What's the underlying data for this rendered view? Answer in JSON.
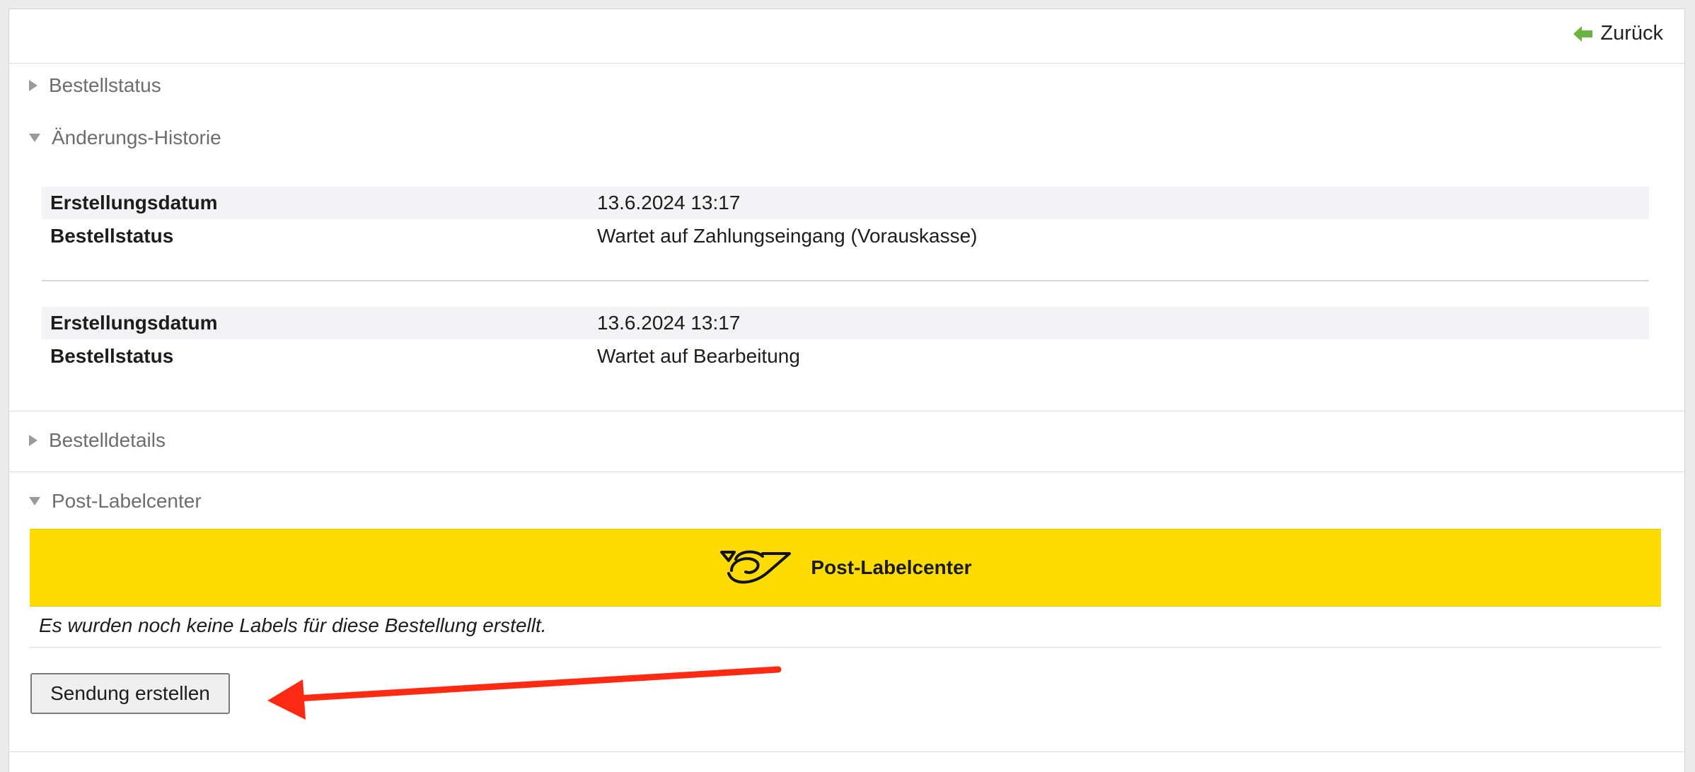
{
  "header": {
    "back_label": "Zurück",
    "back_icon": "arrow-left-icon",
    "accent_color": "#6db33f"
  },
  "sections": {
    "order_status": {
      "title": "Bestellstatus"
    },
    "history": {
      "title": "Änderungs-Historie",
      "entries": [
        {
          "date_label": "Erstellungsdatum",
          "date_value": "13.6.2024 13:17",
          "status_label": "Bestellstatus",
          "status_value": "Wartet auf Zahlungseingang (Vorauskasse)"
        },
        {
          "date_label": "Erstellungsdatum",
          "date_value": "13.6.2024 13:17",
          "status_label": "Bestellstatus",
          "status_value": "Wartet auf Bearbeitung"
        }
      ]
    },
    "order_details": {
      "title": "Bestelldetails"
    },
    "label_center": {
      "title": "Post-Labelcenter",
      "banner_title": "Post-Labelcenter",
      "banner_color": "#ffdc00",
      "empty_note": "Es wurden noch keine Labels für diese Bestellung erstellt.",
      "create_button": "Sendung erstellen"
    }
  },
  "annotation": {
    "arrow_color": "#ff2a12",
    "icon": "red-arrow-icon"
  }
}
